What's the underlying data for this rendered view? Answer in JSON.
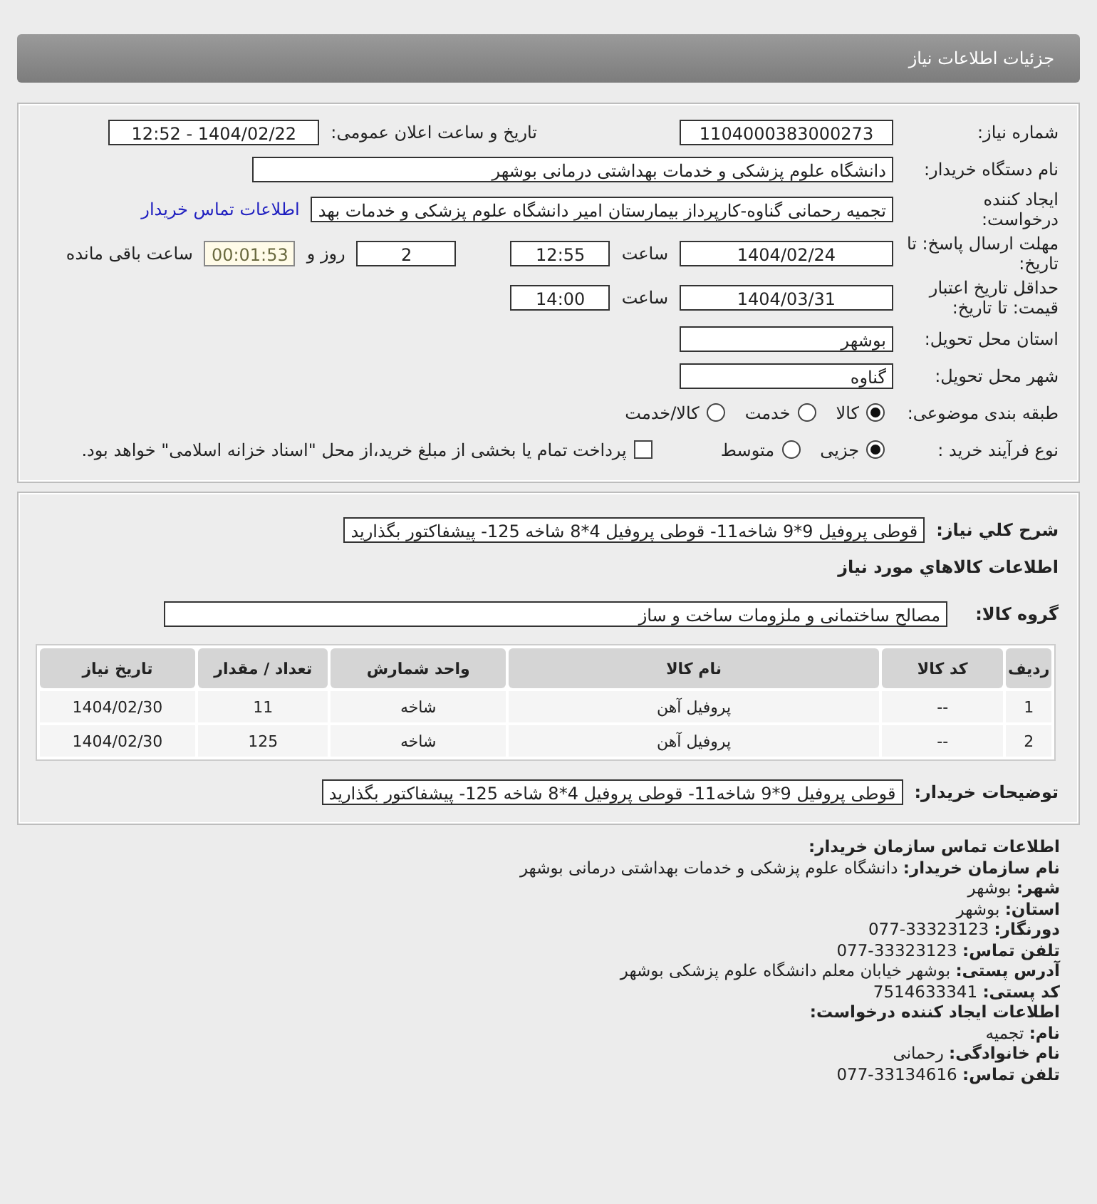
{
  "header": {
    "title": "جزئیات اطلاعات نیاز"
  },
  "form": {
    "need_number": {
      "label": "شماره نیاز:",
      "value": "1104000383000273"
    },
    "announce": {
      "label": "تاریخ و ساعت اعلان عمومی:",
      "value": "1404/02/22 - 12:52"
    },
    "buyer": {
      "label": "نام دستگاه خریدار:",
      "value": "دانشگاه علوم پزشکی و خدمات بهداشتی درمانی بوشهر"
    },
    "creator": {
      "label": "ایجاد کننده درخواست:",
      "value": "تجمیه رحمانی گناوه-کارپرداز بیمارستان امیر دانشگاه علوم پزشکی و خدمات بهد",
      "link": "اطلاعات تماس خریدار"
    },
    "deadline": {
      "label": "مهلت ارسال پاسخ: تا تاریخ:",
      "date": "1404/02/24",
      "time_label": "ساعت",
      "time": "12:55",
      "days": "2",
      "days_label": "روز و",
      "remaining": "00:01:53",
      "remaining_label": "ساعت باقی مانده"
    },
    "validity": {
      "label": "حداقل تاریخ اعتبار قیمت: تا تاریخ:",
      "date": "1404/03/31",
      "time_label": "ساعت",
      "time": "14:00"
    },
    "province": {
      "label": "استان محل تحویل:",
      "value": "بوشهر"
    },
    "city": {
      "label": "شهر محل تحویل:",
      "value": "گناوه"
    },
    "category": {
      "label": "طبقه بندی موضوعی:",
      "options": [
        {
          "label": "کالا",
          "selected": true
        },
        {
          "label": "خدمت",
          "selected": false
        },
        {
          "label": "کالا/خدمت",
          "selected": false
        }
      ]
    },
    "process": {
      "label": "نوع فرآیند خرید :",
      "options": [
        {
          "label": "جزیی",
          "selected": true
        },
        {
          "label": "متوسط",
          "selected": false
        }
      ],
      "payment": {
        "checked": false,
        "text": "پرداخت تمام یا بخشی از مبلغ خرید،از محل \"اسناد خزانه اسلامی\" خواهد بود."
      }
    }
  },
  "goods": {
    "description": {
      "label": "شرح کلي نياز:",
      "value": "قوطی پروفیل 9*9 شاخه11- قوطی پروفیل 4*8 شاخه 125- پیشفاکتور بگذارید"
    },
    "section_title": "اطلاعات کالاهاي مورد نياز",
    "group": {
      "label": "گروه کالا:",
      "value": "مصالح ساختمانی و ملزومات ساخت  و ساز"
    },
    "table": {
      "columns": [
        "ردیف",
        "کد کالا",
        "نام کالا",
        "واحد شمارش",
        "تعداد / مقدار",
        "تاریخ نیاز"
      ],
      "rows": [
        [
          "1",
          "--",
          "پروفیل آهن",
          "شاخه",
          "11",
          "1404/02/30"
        ],
        [
          "2",
          "--",
          "پروفیل آهن",
          "شاخه",
          "125",
          "1404/02/30"
        ]
      ]
    },
    "buyer_notes": {
      "label": "توضیحات خریدار:",
      "value": "قوطی پروفیل 9*9 شاخه11- قوطی پروفیل 4*8 شاخه 125- پیشفاکتور بگذارید"
    }
  },
  "contact": [
    {
      "kind": "heading",
      "text": "اطلاعات تماس سازمان خریدار:"
    },
    {
      "kind": "field",
      "label": "نام سازمان خریدار:",
      "value": "دانشگاه علوم پزشکی و خدمات بهداشتی درمانی بوشهر"
    },
    {
      "kind": "field",
      "label": "شهر:",
      "value": "بوشهر"
    },
    {
      "kind": "field",
      "label": "استان:",
      "value": "بوشهر"
    },
    {
      "kind": "field",
      "label": "دورنگار:",
      "value": "33323123-077"
    },
    {
      "kind": "field",
      "label": "تلفن تماس:",
      "value": "33323123-077"
    },
    {
      "kind": "field",
      "label": "آدرس پستی:",
      "value": "بوشهر خیابان معلم دانشگاه علوم پزشکی بوشهر"
    },
    {
      "kind": "field",
      "label": "کد پستی:",
      "value": "7514633341"
    },
    {
      "kind": "heading",
      "text": "اطلاعات ایجاد کننده درخواست:"
    },
    {
      "kind": "field",
      "label": "نام:",
      "value": "تجمیه"
    },
    {
      "kind": "field",
      "label": "نام خانوادگی:",
      "value": "رحمانی"
    },
    {
      "kind": "field",
      "label": "تلفن تماس:",
      "value": "33134616-077"
    }
  ]
}
